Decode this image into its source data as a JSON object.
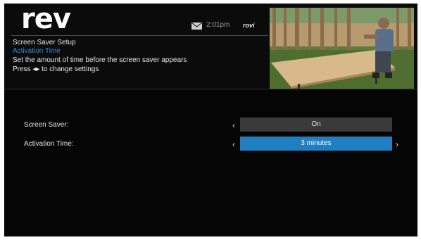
{
  "header": {
    "logo": "rev",
    "time": "2:01pm",
    "brand": "rovi",
    "icons": {
      "mail": "mail-icon"
    }
  },
  "info": {
    "title": "Screen Saver Setup",
    "subtitle": "Activation Time",
    "description": "Set the amount of time before the screen saver appears",
    "instruction": "Press ◂▸ to change settings"
  },
  "settings": [
    {
      "label": "Screen Saver:",
      "value": "On"
    },
    {
      "label": "Activation Time:",
      "value": "3 minutes"
    }
  ],
  "glyphs": {
    "left": "‹",
    "right": "›"
  },
  "colors": {
    "accent": "#1f7fc0",
    "subtitle": "#2f8fd6",
    "background": "#050505"
  }
}
